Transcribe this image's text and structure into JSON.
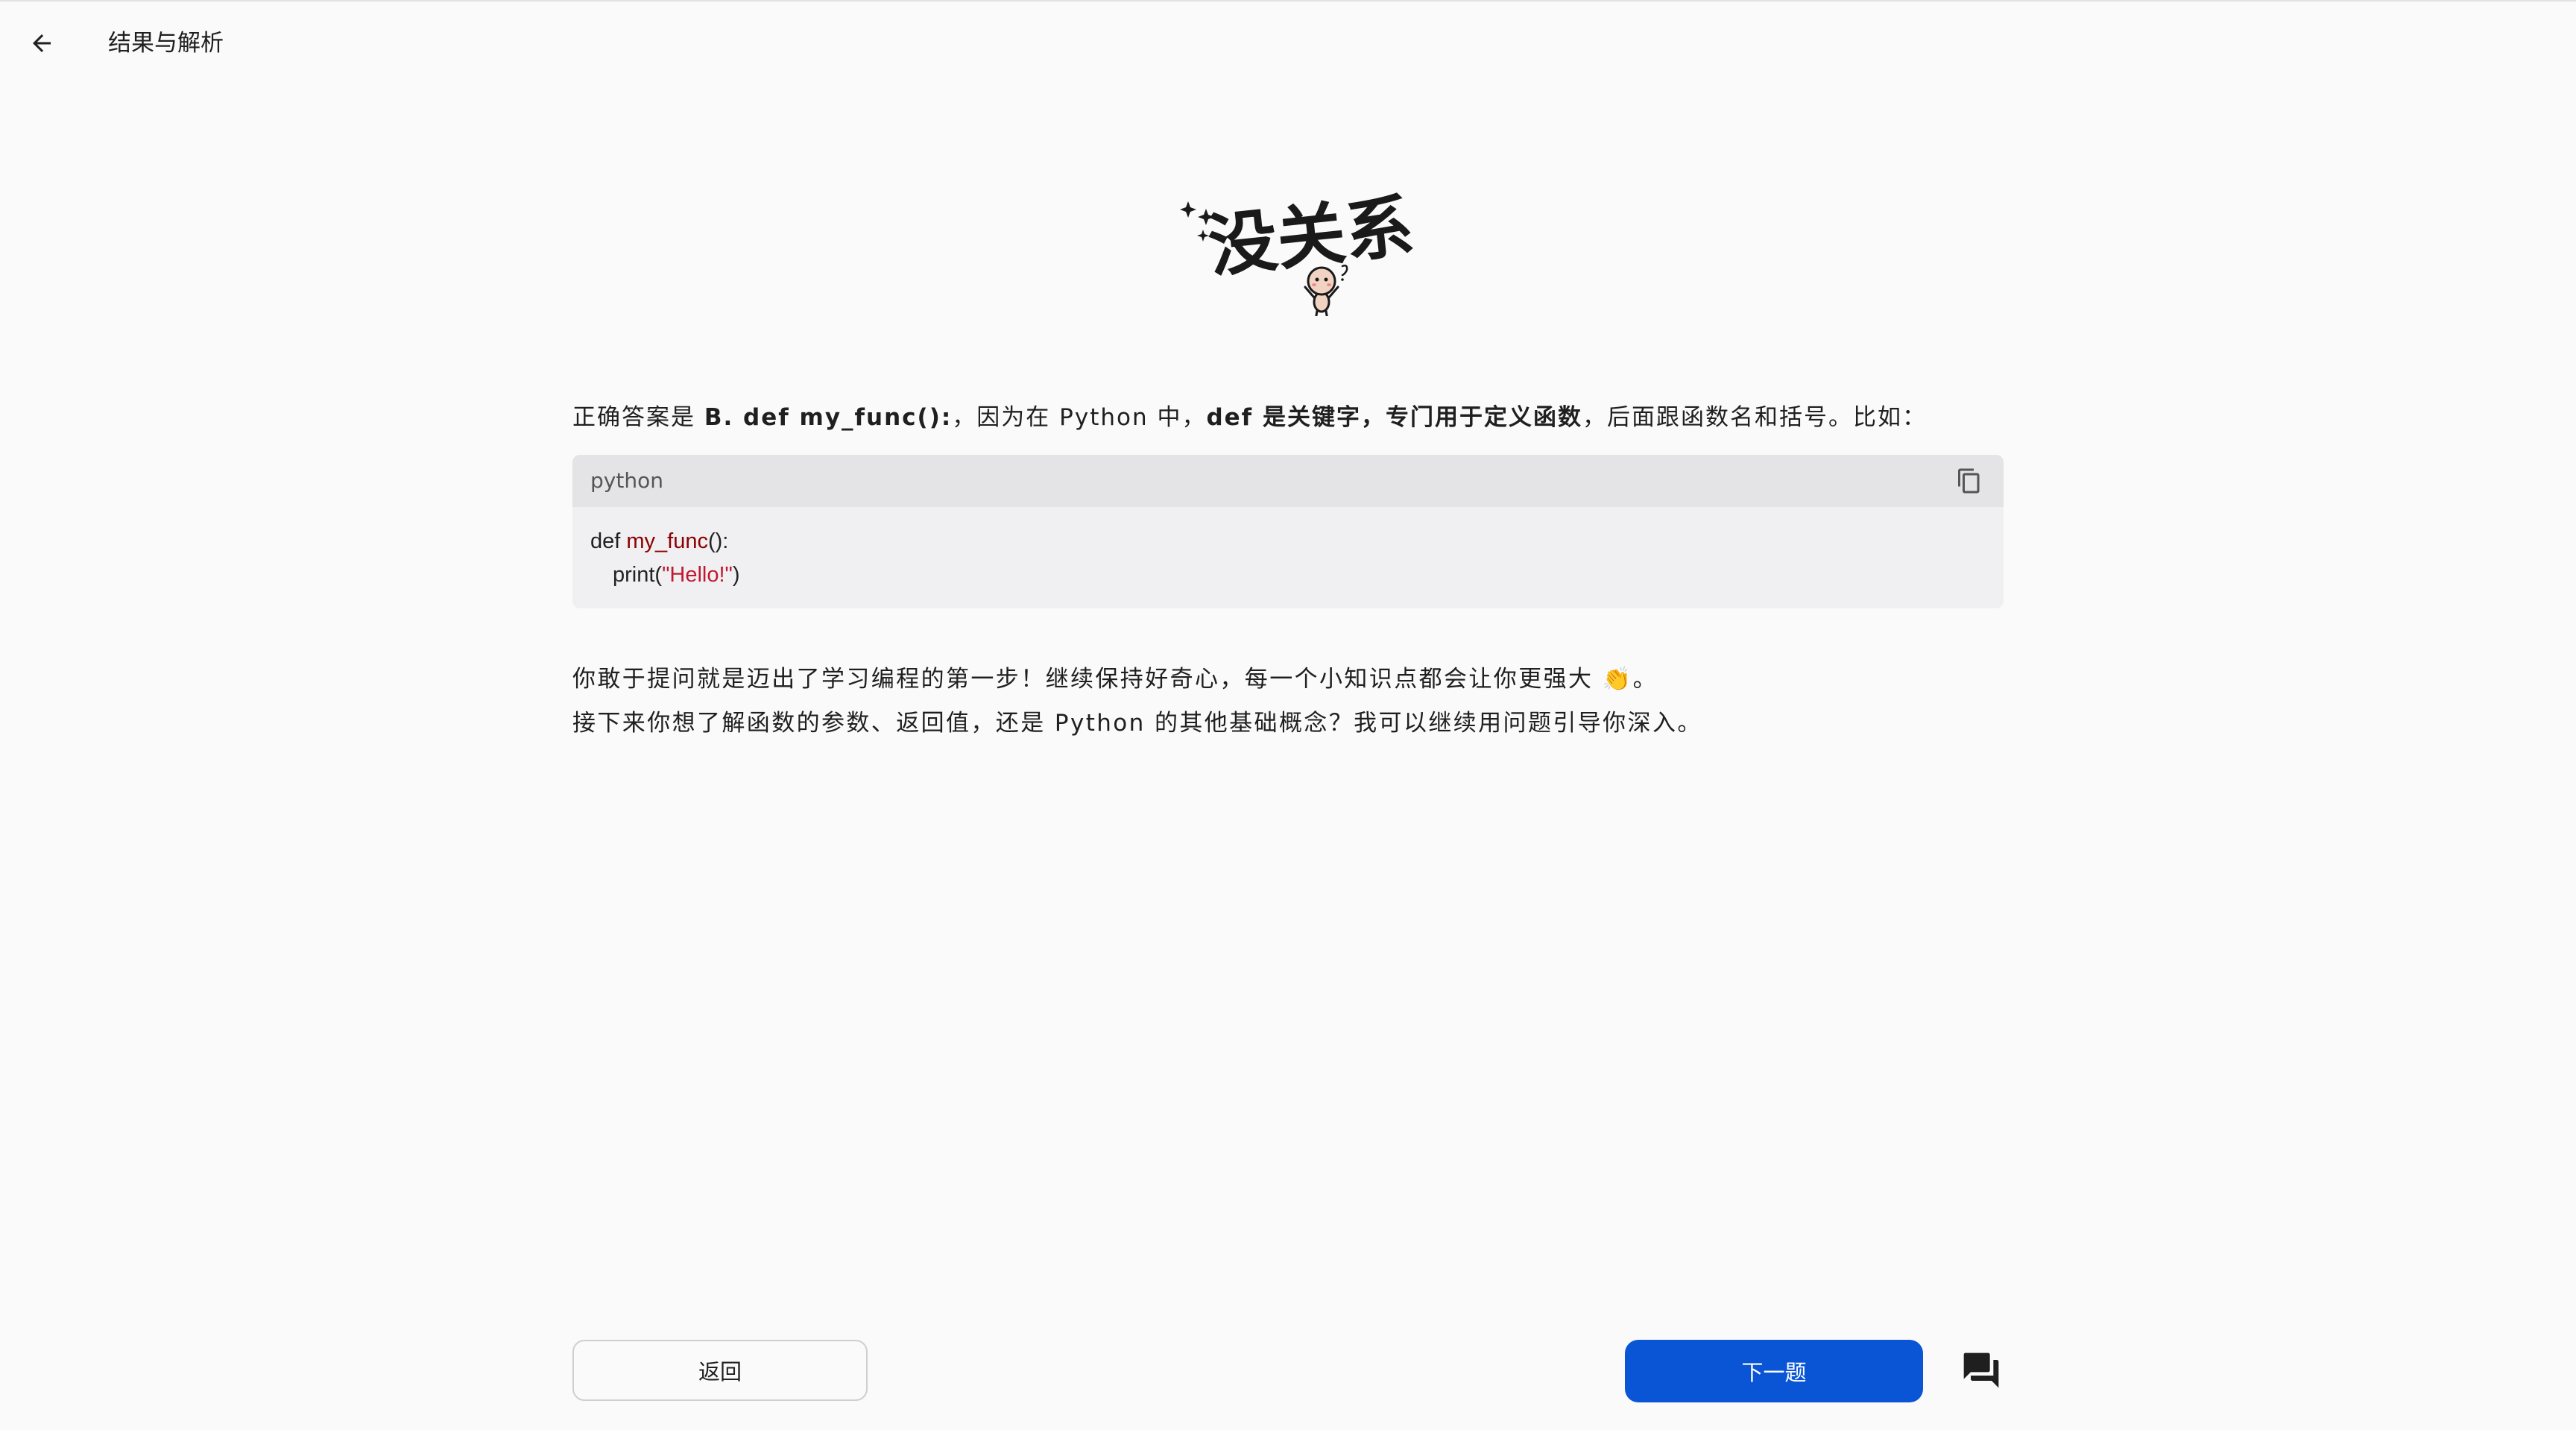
{
  "header": {
    "title": "结果与解析",
    "back_icon": "arrow-left-icon"
  },
  "illustration": {
    "text": "没关系!",
    "icon": "encouraging-character-illustration"
  },
  "answer": {
    "prefix": "正确答案是 ",
    "option": "B. def my_func():",
    "middle": "，因为在 Python 中，",
    "emphasis": "def 是关键字，专门用于定义函数",
    "suffix": "，后面跟函数名和括号。比如："
  },
  "code": {
    "language": "python",
    "copy_icon": "copy-icon",
    "line1_keyword": "def ",
    "line1_fn": "my_func",
    "line1_rest": "():",
    "line2_pre": "print(",
    "line2_str": "\"Hello!\"",
    "line2_post": ")"
  },
  "encouragement": {
    "line1": "你敢于提问就是迈出了学习编程的第一步！继续保持好奇心，每一个小知识点都会让你更强大 ",
    "emoji": "👏",
    "line1_end": "。",
    "line2": "接下来你想了解函数的参数、返回值，还是 Python 的其他基础概念？我可以继续用问题引导你深入。"
  },
  "footer": {
    "back_label": "返回",
    "next_label": "下一题",
    "chat_icon": "chat-bubbles-icon"
  },
  "colors": {
    "primary": "#0a55d6",
    "background": "#fafafa",
    "code_bg": "#f0f0f2",
    "code_header_bg": "#e4e4e7",
    "function_name": "#8b0000",
    "string": "#c01830"
  }
}
